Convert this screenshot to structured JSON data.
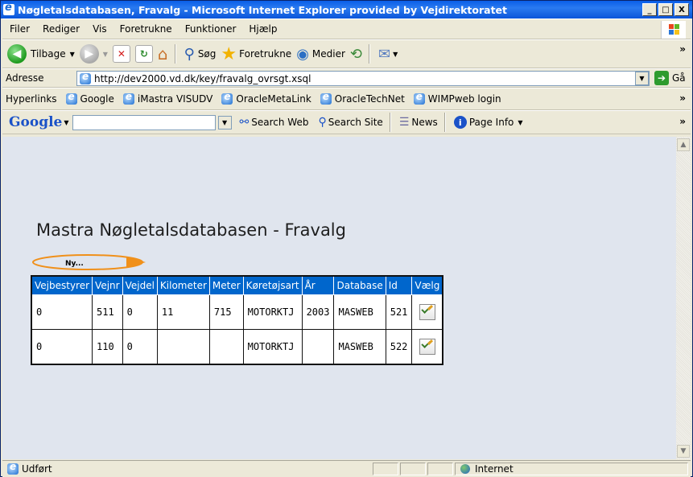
{
  "window": {
    "title": "Nøgletalsdatabasen, Fravalg - Microsoft Internet Explorer provided by Vejdirektoratet",
    "min": "_",
    "max": "□",
    "close": "X"
  },
  "menu": [
    "Filer",
    "Rediger",
    "Vis",
    "Foretrukne",
    "Funktioner",
    "Hjælp"
  ],
  "toolbar": {
    "back": "Tilbage",
    "search": "Søg",
    "favorites": "Foretrukne",
    "media": "Medier"
  },
  "address": {
    "label": "Adresse",
    "url": "http://dev2000.vd.dk/key/fravalg_ovrsgt.xsql",
    "go": "Gå"
  },
  "links": {
    "label": "Hyperlinks",
    "items": [
      "Google",
      "iMastra VISUDV",
      "OracleMetaLink",
      "OracleTechNet",
      "WIMPweb login"
    ]
  },
  "google": {
    "logo": "Google",
    "search_web": "Search Web",
    "search_site": "Search Site",
    "news": "News",
    "page_info": "Page Info"
  },
  "page": {
    "heading": "Mastra Nøgletalsdatabasen - Fravalg",
    "new_button": "Ny...",
    "columns": [
      "Vejbestyrer",
      "Vejnr",
      "Vejdel",
      "Kilometer",
      "Meter",
      "Køretøjsart",
      "År",
      "Database",
      "Id",
      "Vælg"
    ],
    "rows": [
      [
        "0",
        "511",
        "0",
        "11",
        "715",
        "MOTORKTJ",
        "2003",
        "MASWEB",
        "521"
      ],
      [
        "0",
        "110",
        "0",
        "",
        "",
        "MOTORKTJ",
        "",
        "MASWEB",
        "522"
      ]
    ]
  },
  "status": {
    "text": "Udført",
    "zone": "Internet"
  },
  "overflow_glyph": "»",
  "colors": {
    "table_header": "#0066cc",
    "content_bg": "#e0e5ee",
    "titlebar": "#0a5ee8",
    "new_button_ring": "#f0901a"
  }
}
